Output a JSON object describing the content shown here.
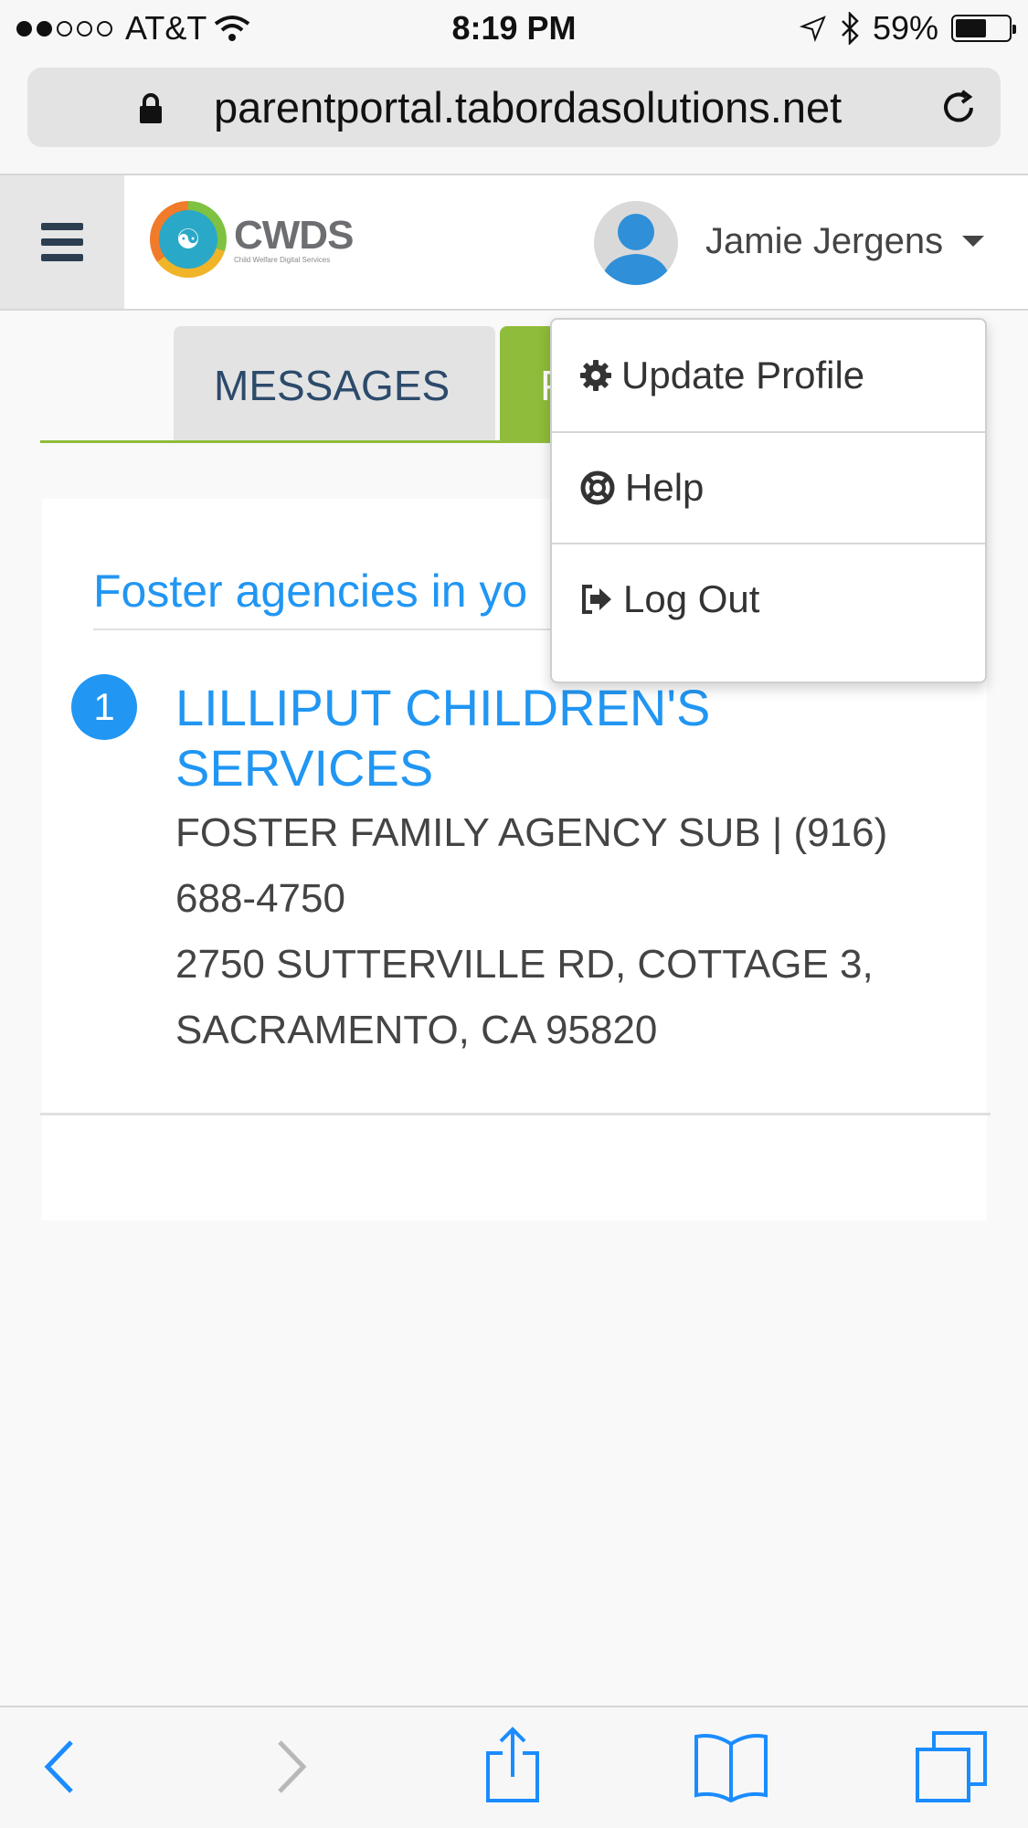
{
  "status_bar": {
    "carrier": "AT&T",
    "time": "8:19 PM",
    "battery": "59%",
    "battery_level": 0.59
  },
  "browser": {
    "url": "parentportal.tabordasolutions.net"
  },
  "header": {
    "logo_brand": "CWDS",
    "logo_tagline": "Child Welfare Digital Services",
    "user_name": "Jamie Jergens"
  },
  "tabs": [
    {
      "label": "MESSAGES"
    },
    {
      "label": "P"
    }
  ],
  "dropdown": {
    "items": [
      {
        "label": "Update Profile",
        "icon": "gear-icon"
      },
      {
        "label": "Help",
        "icon": "life-ring-icon"
      },
      {
        "label": "Log Out",
        "icon": "sign-out-icon"
      }
    ]
  },
  "content": {
    "heading": "Foster agencies in yo",
    "items": [
      {
        "number": "1",
        "name": "LILLIPUT CHILDREN'S SERVICES",
        "type_phone": "FOSTER FAMILY AGENCY SUB | (916) 688-4750",
        "address": "2750 SUTTERVILLE RD, COTTAGE 3, SACRAMENTO, CA 95820"
      }
    ]
  },
  "colors": {
    "accent_blue": "#2196f3",
    "tab_green": "#8fbc3a",
    "nav_dark": "#2c3e50"
  }
}
